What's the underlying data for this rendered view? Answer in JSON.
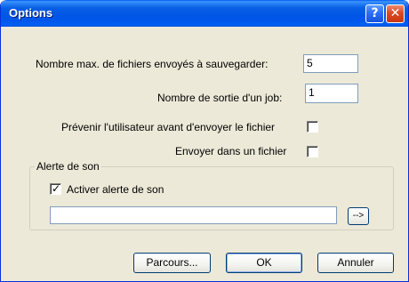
{
  "window": {
    "title": "Options",
    "help_glyph": "?",
    "close_glyph": "✕",
    "help_icon": "help-icon",
    "close_icon": "close-icon",
    "titlebar_color": "#0054e3",
    "face_color": "#ece9d8"
  },
  "fields": {
    "max_files_label": "Nombre max. de fichiers envoyés à sauvegarder:",
    "max_files_value": "5",
    "job_output_label": "Nombre de sortie d'un job:",
    "job_output_value": "1"
  },
  "options": {
    "warn_user_label": "Prévenir l'utilisateur avant d'envoyer le fichier",
    "warn_user_checked": false,
    "send_to_file_label": "Envoyer dans un fichier",
    "send_to_file_checked": false
  },
  "sound_alert": {
    "group_label": "Alerte de son",
    "enable_label": "Activer alerte de son",
    "enable_checked": true,
    "check_glyph": "✓",
    "path_value": "",
    "browse_arrow_label": "-->"
  },
  "buttons": {
    "browse_label": "Parcours...",
    "ok_label": "OK",
    "cancel_label": "Annuler"
  }
}
